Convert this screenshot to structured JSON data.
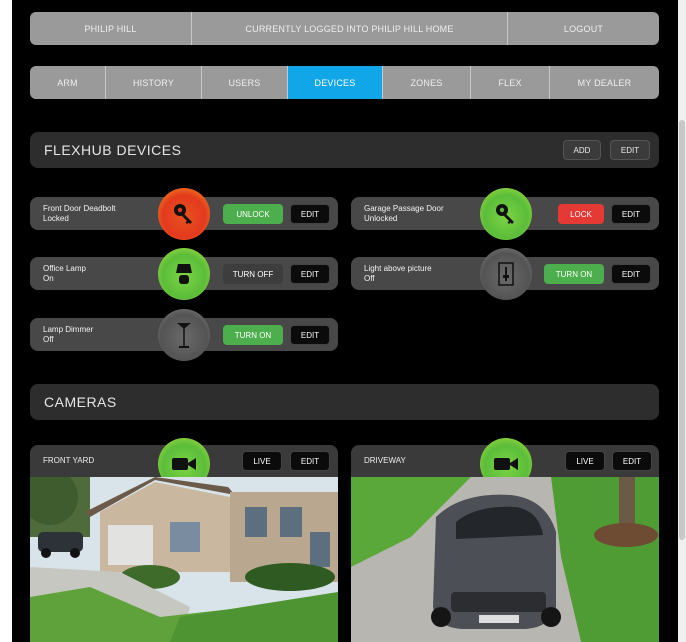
{
  "userbar": {
    "user": "PHILIP HILL",
    "message": "CURRENTLY LOGGED INTO PHILIP HILL HOME",
    "logout": "LOGOUT"
  },
  "nav": {
    "tabs": [
      "ARM",
      "HISTORY",
      "USERS",
      "DEVICES",
      "ZONES",
      "FLEX",
      "MY DEALER"
    ],
    "active": "DEVICES"
  },
  "flexhub": {
    "title": "FLEXHUB DEVICES",
    "add": "ADD",
    "edit": "EDIT"
  },
  "devices": [
    {
      "name": "Front Door Deadbolt",
      "status": "Locked",
      "action": "UNLOCK",
      "edit": "EDIT",
      "icon": "key-icon"
    },
    {
      "name": "Garage Passage Door",
      "status": "Unlocked",
      "action": "LOCK",
      "edit": "EDIT",
      "icon": "key-icon"
    },
    {
      "name": "Office Lamp",
      "status": "On",
      "action": "TURN OFF",
      "edit": "EDIT",
      "icon": "lamp-icon"
    },
    {
      "name": "Light above picture",
      "status": "Off",
      "action": "TURN ON",
      "edit": "EDIT",
      "icon": "switch-icon"
    },
    {
      "name": "Lamp Dimmer",
      "status": "Off",
      "action": "TURN ON",
      "edit": "EDIT",
      "icon": "floor-lamp-icon"
    }
  ],
  "cameras": {
    "title": "CAMERAS",
    "items": [
      {
        "name": "FRONT YARD",
        "live": "LIVE",
        "edit": "EDIT",
        "icon": "video-camera-icon"
      },
      {
        "name": "DRIVEWAY",
        "live": "LIVE",
        "edit": "EDIT",
        "icon": "video-camera-icon"
      }
    ]
  },
  "colors": {
    "active_tab": "#10a6e8",
    "green_button": "#4cae4c",
    "red_button": "#e53935",
    "locked_circle": "#e33a1f",
    "unlocked_circle": "#5bbd3a"
  }
}
